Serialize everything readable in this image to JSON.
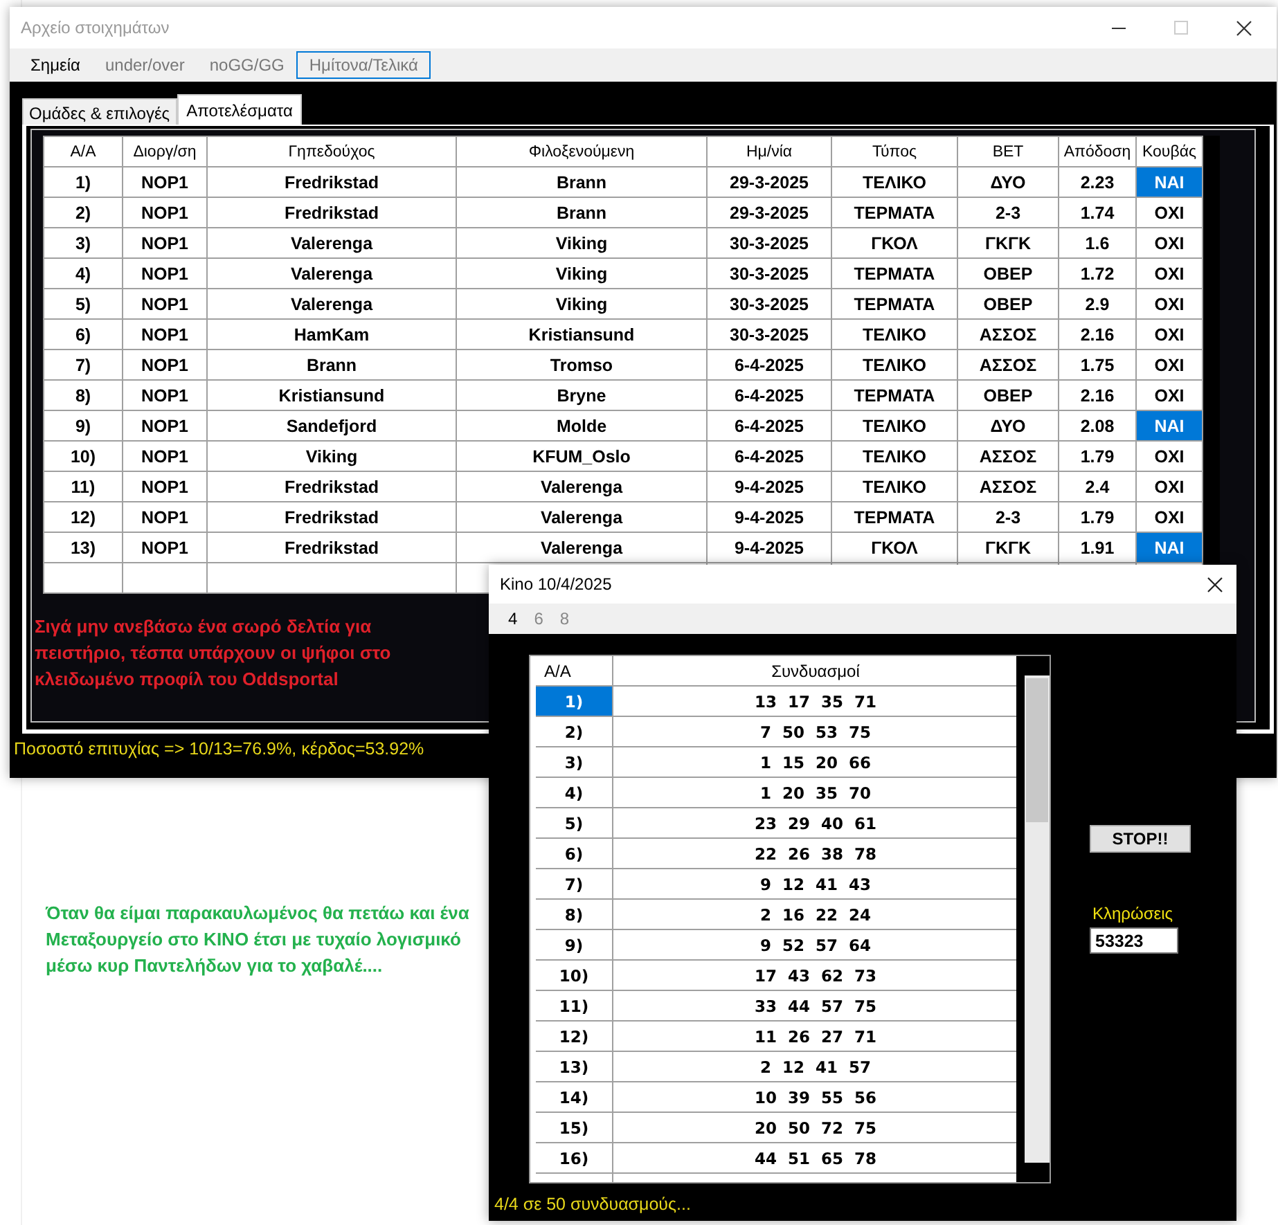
{
  "main_window": {
    "title": "Αρχείο στοιχημάτων",
    "menu": [
      {
        "label": "Σημεία",
        "selected": false,
        "disabled": false
      },
      {
        "label": "under/over",
        "selected": false,
        "disabled": true
      },
      {
        "label": "noGG/GG",
        "selected": false,
        "disabled": true
      },
      {
        "label": "Ημίτονα/Τελικά",
        "selected": true,
        "disabled": true
      }
    ],
    "tabs": [
      {
        "label": "Ομάδες & επιλογές",
        "selected": false
      },
      {
        "label": "Αποτελέσματα",
        "selected": true
      }
    ],
    "table": {
      "columns": [
        "A/A",
        "Διοργ/ση",
        "Γηπεδούχος",
        "Φιλοξενούμενη",
        "Ημ/νία",
        "Τύπος",
        "BET",
        "Απόδοση",
        "Κουβάς"
      ],
      "rows": [
        {
          "cells": [
            "1)",
            "NOP1",
            "Fredrikstad",
            "Brann",
            "29-3-2025",
            "ΤΕΛΙΚΟ",
            "ΔΥΟ",
            "2.23",
            "ΝΑΙ"
          ],
          "highlighted": true
        },
        {
          "cells": [
            "2)",
            "NOP1",
            "Fredrikstad",
            "Brann",
            "29-3-2025",
            "ΤΕΡΜΑΤΑ",
            "2-3",
            "1.74",
            "ΟΧΙ"
          ],
          "highlighted": false
        },
        {
          "cells": [
            "3)",
            "NOP1",
            "Valerenga",
            "Viking",
            "30-3-2025",
            "ΓΚΟΛ",
            "ΓΚΓΚ",
            "1.6",
            "ΟΧΙ"
          ],
          "highlighted": false
        },
        {
          "cells": [
            "4)",
            "NOP1",
            "Valerenga",
            "Viking",
            "30-3-2025",
            "ΤΕΡΜΑΤΑ",
            "ΟΒΕΡ",
            "1.72",
            "ΟΧΙ"
          ],
          "highlighted": false
        },
        {
          "cells": [
            "5)",
            "NOP1",
            "Valerenga",
            "Viking",
            "30-3-2025",
            "ΤΕΡΜΑΤΑ",
            "ΟΒΕΡ",
            "2.9",
            "ΟΧΙ"
          ],
          "highlighted": false
        },
        {
          "cells": [
            "6)",
            "NOP1",
            "HamKam",
            "Kristiansund",
            "30-3-2025",
            "ΤΕΛΙΚΟ",
            "ΑΣΣΟΣ",
            "2.16",
            "ΟΧΙ"
          ],
          "highlighted": false
        },
        {
          "cells": [
            "7)",
            "NOP1",
            "Brann",
            "Tromso",
            "6-4-2025",
            "ΤΕΛΙΚΟ",
            "ΑΣΣΟΣ",
            "1.75",
            "ΟΧΙ"
          ],
          "highlighted": false
        },
        {
          "cells": [
            "8)",
            "NOP1",
            "Kristiansund",
            "Bryne",
            "6-4-2025",
            "ΤΕΡΜΑΤΑ",
            "ΟΒΕΡ",
            "2.16",
            "ΟΧΙ"
          ],
          "highlighted": false
        },
        {
          "cells": [
            "9)",
            "NOP1",
            "Sandefjord",
            "Molde",
            "6-4-2025",
            "ΤΕΛΙΚΟ",
            "ΔΥΟ",
            "2.08",
            "ΝΑΙ"
          ],
          "highlighted": true
        },
        {
          "cells": [
            "10)",
            "NOP1",
            "Viking",
            "KFUM_Oslo",
            "6-4-2025",
            "ΤΕΛΙΚΟ",
            "ΑΣΣΟΣ",
            "1.79",
            "ΟΧΙ"
          ],
          "highlighted": false
        },
        {
          "cells": [
            "11)",
            "NOP1",
            "Fredrikstad",
            "Valerenga",
            "9-4-2025",
            "ΤΕΛΙΚΟ",
            "ΑΣΣΟΣ",
            "2.4",
            "ΟΧΙ"
          ],
          "highlighted": false
        },
        {
          "cells": [
            "12)",
            "NOP1",
            "Fredrikstad",
            "Valerenga",
            "9-4-2025",
            "ΤΕΡΜΑΤΑ",
            "2-3",
            "1.79",
            "ΟΧΙ"
          ],
          "highlighted": false
        },
        {
          "cells": [
            "13)",
            "NOP1",
            "Fredrikstad",
            "Valerenga",
            "9-4-2025",
            "ΓΚΟΛ",
            "ΓΚΓΚ",
            "1.91",
            "ΝΑΙ"
          ],
          "highlighted": true
        }
      ]
    },
    "note": "Σιγά μην ανεβάσω ένα σωρό δελτία για πειστήριο, τέσπα υπάρχουν οι ψήφοι στο κλειδωμένο προφίλ του Oddsportal",
    "status": "Ποσοστό επιτυχίας => 10/13=76.9%,  κέρδος=53.92%"
  },
  "background_note": "Όταν θα είμαι παρακαυλωμένος θα πετάω και ένα Μεταξουργείο στο ΚΙΝΟ έτσι με τυχαίο λογισμικό μέσω κυρ Παντελήδων για το χαβαλέ....",
  "kino_window": {
    "title": "Kino 10/4/2025",
    "tabs": [
      {
        "label": "4",
        "selected": true
      },
      {
        "label": "6",
        "selected": false
      },
      {
        "label": "8",
        "selected": false
      }
    ],
    "table": {
      "columns": [
        "A/A",
        "Συνδυασμοί"
      ],
      "rows": [
        {
          "index": "1)",
          "numbers": "13  17  35  71",
          "selected": true
        },
        {
          "index": "2)",
          "numbers": "7  50  53  75",
          "selected": false
        },
        {
          "index": "3)",
          "numbers": "1  15  20  66",
          "selected": false
        },
        {
          "index": "4)",
          "numbers": "1  20  35  70",
          "selected": false
        },
        {
          "index": "5)",
          "numbers": "23  29  40  61",
          "selected": false
        },
        {
          "index": "6)",
          "numbers": "22  26  38  78",
          "selected": false
        },
        {
          "index": "7)",
          "numbers": "9  12  41  43",
          "selected": false
        },
        {
          "index": "8)",
          "numbers": "2  16  22  24",
          "selected": false
        },
        {
          "index": "9)",
          "numbers": "9  52  57  64",
          "selected": false
        },
        {
          "index": "10)",
          "numbers": "17  43  62  73",
          "selected": false
        },
        {
          "index": "11)",
          "numbers": "33  44  57  75",
          "selected": false
        },
        {
          "index": "12)",
          "numbers": "11  26  27  71",
          "selected": false
        },
        {
          "index": "13)",
          "numbers": "2  12  41  57",
          "selected": false
        },
        {
          "index": "14)",
          "numbers": "10  39  55  56",
          "selected": false
        },
        {
          "index": "15)",
          "numbers": "20  50  72  75",
          "selected": false
        },
        {
          "index": "16)",
          "numbers": "44  51  65  78",
          "selected": false
        }
      ]
    },
    "stop_button": "STOP!!",
    "draws_label": "Κληρώσεις",
    "draws_value": "53323",
    "status": "4/4 σε 50 συνδυασμούς..."
  }
}
